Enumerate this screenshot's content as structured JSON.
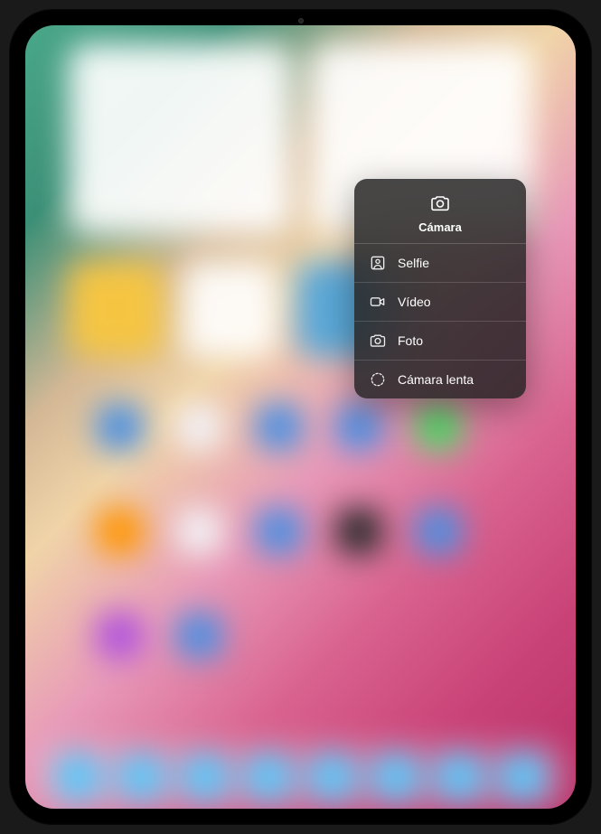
{
  "contextMenu": {
    "title": "Cámara",
    "items": [
      {
        "icon": "selfie-icon",
        "label": "Selfie"
      },
      {
        "icon": "video-icon",
        "label": "Vídeo"
      },
      {
        "icon": "photo-icon",
        "label": "Foto"
      },
      {
        "icon": "slomo-icon",
        "label": "Cámara lenta"
      }
    ]
  }
}
